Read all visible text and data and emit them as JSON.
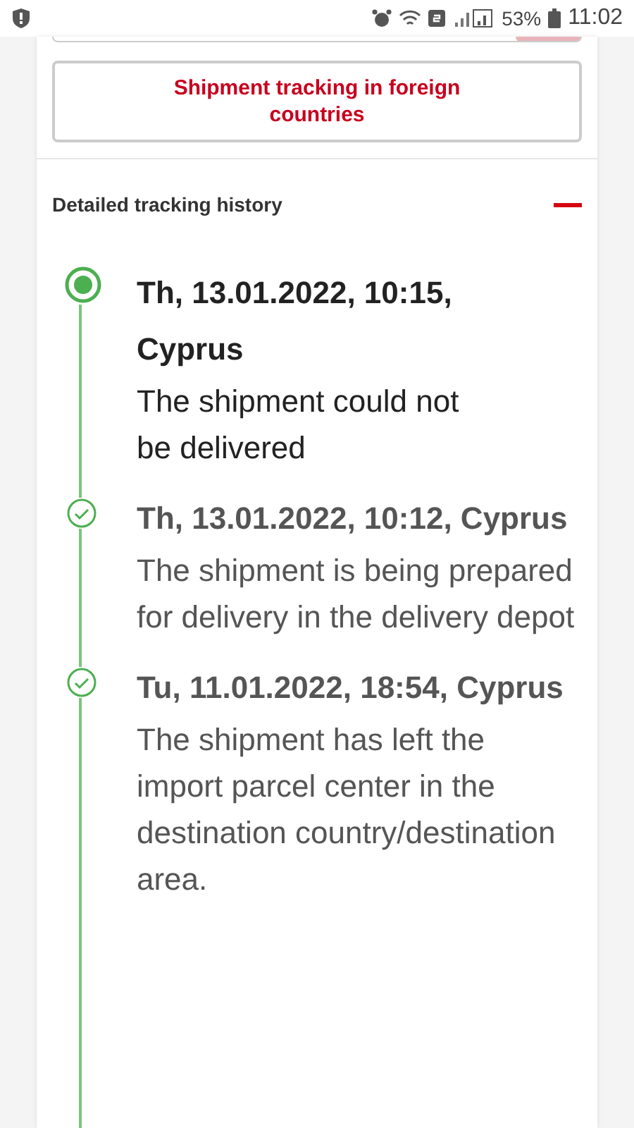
{
  "status_bar": {
    "battery": "53%",
    "time": "11:02"
  },
  "foreign_tracking_button": "Shipment tracking in foreign countries",
  "history": {
    "title": "Detailed tracking history",
    "expanded": true,
    "events": [
      {
        "kind": "current",
        "heading": "Th, 13.01.2022, 10:15, Cyprus",
        "text": "The shipment could not be delivered"
      },
      {
        "kind": "done",
        "heading": "Th, 13.01.2022, 10:12, Cyprus",
        "text": "The shipment is being prepared for delivery in the delivery depot"
      },
      {
        "kind": "done",
        "heading": "Tu, 11.01.2022, 18:54, Cyprus",
        "text": "The shipment has left the import parcel center in the destination country/destination area."
      }
    ]
  }
}
